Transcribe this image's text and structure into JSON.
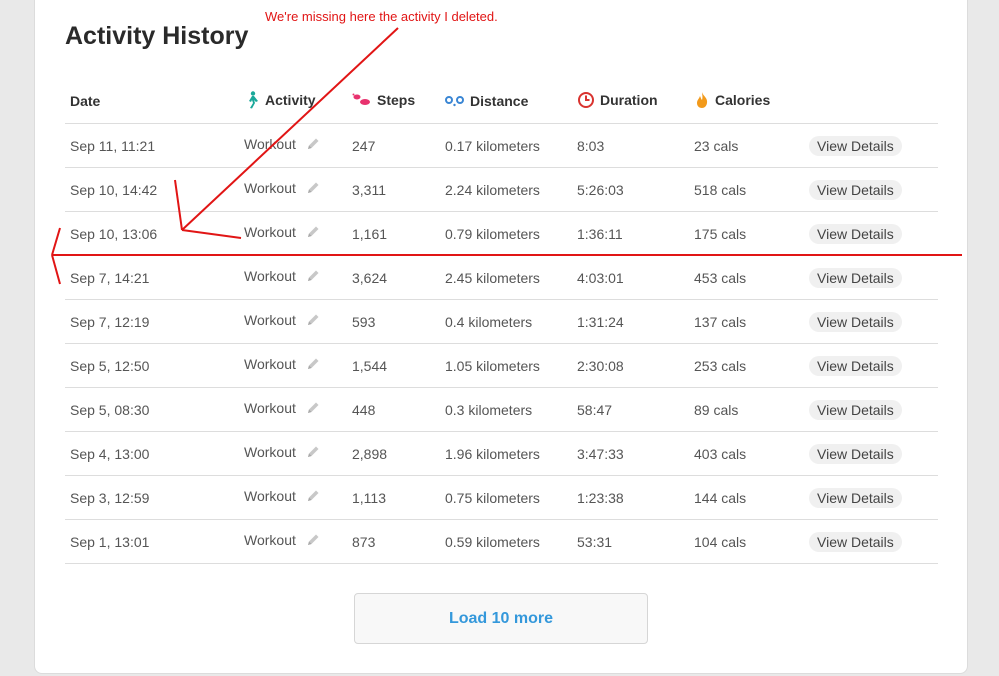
{
  "title": "Activity History",
  "headers": {
    "date": "Date",
    "activity": "Activity",
    "steps": "Steps",
    "distance": "Distance",
    "duration": "Duration",
    "calories": "Calories"
  },
  "icons": {
    "activity": "walking-person-icon",
    "steps": "footprints-icon",
    "distance": "distance-icon",
    "duration": "clock-icon",
    "calories": "flame-icon",
    "edit": "pencil-icon"
  },
  "rows": [
    {
      "date": "Sep 11, 11:21",
      "activity": "Workout",
      "steps": "247",
      "distance": "0.17 kilometers",
      "duration": "8:03",
      "calories": "23 cals",
      "action": "View Details"
    },
    {
      "date": "Sep 10, 14:42",
      "activity": "Workout",
      "steps": "3,311",
      "distance": "2.24 kilometers",
      "duration": "5:26:03",
      "calories": "518 cals",
      "action": "View Details"
    },
    {
      "date": "Sep 10, 13:06",
      "activity": "Workout",
      "steps": "1,161",
      "distance": "0.79 kilometers",
      "duration": "1:36:11",
      "calories": "175 cals",
      "action": "View Details"
    },
    {
      "date": "Sep 7, 14:21",
      "activity": "Workout",
      "steps": "3,624",
      "distance": "2.45 kilometers",
      "duration": "4:03:01",
      "calories": "453 cals",
      "action": "View Details"
    },
    {
      "date": "Sep 7, 12:19",
      "activity": "Workout",
      "steps": "593",
      "distance": "0.4 kilometers",
      "duration": "1:31:24",
      "calories": "137 cals",
      "action": "View Details"
    },
    {
      "date": "Sep 5, 12:50",
      "activity": "Workout",
      "steps": "1,544",
      "distance": "1.05 kilometers",
      "duration": "2:30:08",
      "calories": "253 cals",
      "action": "View Details"
    },
    {
      "date": "Sep 5, 08:30",
      "activity": "Workout",
      "steps": "448",
      "distance": "0.3 kilometers",
      "duration": "58:47",
      "calories": "89 cals",
      "action": "View Details"
    },
    {
      "date": "Sep 4, 13:00",
      "activity": "Workout",
      "steps": "2,898",
      "distance": "1.96 kilometers",
      "duration": "3:47:33",
      "calories": "403 cals",
      "action": "View Details"
    },
    {
      "date": "Sep 3, 12:59",
      "activity": "Workout",
      "steps": "1,113",
      "distance": "0.75 kilometers",
      "duration": "1:23:38",
      "calories": "144 cals",
      "action": "View Details"
    },
    {
      "date": "Sep 1, 13:01",
      "activity": "Workout",
      "steps": "873",
      "distance": "0.59 kilometers",
      "duration": "53:31",
      "calories": "104 cals",
      "action": "View Details"
    }
  ],
  "load_more": "Load 10 more",
  "annotation": {
    "text": "We're missing here the activity I deleted.",
    "color": "#e11515"
  },
  "colors": {
    "accent_blue": "#3498db",
    "activity_icon": "#1aa89a",
    "steps_icon": "#e8326e",
    "distance_icon": "#3a86d4",
    "duration_icon": "#d9332f",
    "calories_icon": "#f29a1b"
  }
}
